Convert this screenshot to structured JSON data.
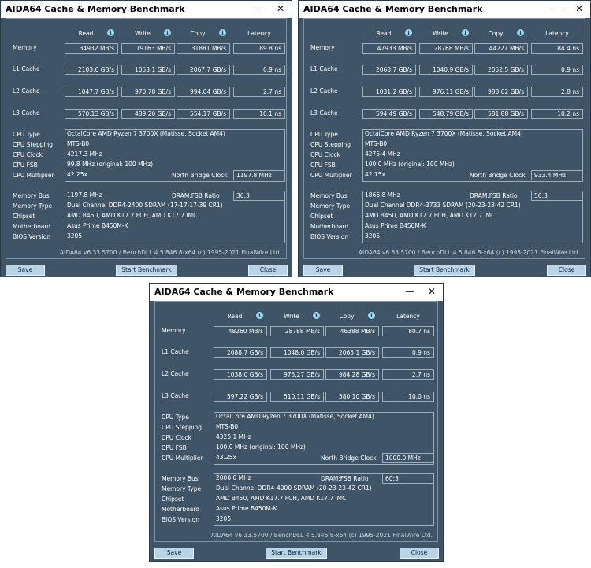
{
  "windows": [
    {
      "title": "AIDA64 Cache & Memory Benchmark",
      "headers": {
        "read": "Read",
        "write": "Write",
        "copy": "Copy",
        "latency": "Latency"
      },
      "rows": [
        {
          "label": "Memory",
          "read": "34932 MB/s",
          "write": "19163 MB/s",
          "copy": "31881 MB/s",
          "latency": "89.8 ns"
        },
        {
          "label": "L1 Cache",
          "read": "2103.6 GB/s",
          "write": "1053.1 GB/s",
          "copy": "2067.7 GB/s",
          "latency": "0.9 ns"
        },
        {
          "label": "L2 Cache",
          "read": "1047.7 GB/s",
          "write": "970.78 GB/s",
          "copy": "994.04 GB/s",
          "latency": "2.7 ns"
        },
        {
          "label": "L3 Cache",
          "read": "570.13 GB/s",
          "write": "489.20 GB/s",
          "copy": "554.17 GB/s",
          "latency": "10.1 ns"
        }
      ],
      "cpu": {
        "type_label": "CPU Type",
        "type": "OctalCore AMD Ryzen 7 3700X  (Matisse, Socket AM4)",
        "stepping_label": "CPU Stepping",
        "stepping": "MTS-B0",
        "clock_label": "CPU Clock",
        "clock": "4217.3 MHz",
        "fsb_label": "CPU FSB",
        "fsb": "99.8 MHz  (original: 100 MHz)",
        "mult_label": "CPU Multiplier",
        "mult": "42.25x",
        "nb_label": "North Bridge Clock",
        "nb": "1197.8 MHz"
      },
      "mem": {
        "bus_label": "Memory Bus",
        "bus": "1197.8 MHz",
        "ratio_label": "DRAM:FSB Ratio",
        "ratio": "36:3",
        "type_label": "Memory Type",
        "type": "Dual Channel DDR4-2400 SDRAM  (17-17-17-39 CR1)",
        "chipset_label": "Chipset",
        "chipset": "AMD B450, AMD K17.7 FCH, AMD K17.7 IMC",
        "mb_label": "Motherboard",
        "mb": "Asus Prime B450M-K",
        "bios_label": "BIOS Version",
        "bios": "3205"
      },
      "footer": "AIDA64 v6.33.5700 / BenchDLL 4.5.846.8-x64  (c) 1995-2021 FinalWire Ltd.",
      "buttons": {
        "save": "Save",
        "start": "Start Benchmark",
        "close": "Close"
      }
    },
    {
      "title": "AIDA64 Cache & Memory Benchmark",
      "headers": {
        "read": "Read",
        "write": "Write",
        "copy": "Copy",
        "latency": "Latency"
      },
      "rows": [
        {
          "label": "Memory",
          "read": "47933 MB/s",
          "write": "28768 MB/s",
          "copy": "44227 MB/s",
          "latency": "84.4 ns"
        },
        {
          "label": "L1 Cache",
          "read": "2068.7 GB/s",
          "write": "1040.9 GB/s",
          "copy": "2052.5 GB/s",
          "latency": "0.9 ns"
        },
        {
          "label": "L2 Cache",
          "read": "1031.2 GB/s",
          "write": "976.11 GB/s",
          "copy": "988.62 GB/s",
          "latency": "2.8 ns"
        },
        {
          "label": "L3 Cache",
          "read": "594.49 GB/s",
          "write": "548.79 GB/s",
          "copy": "581.88 GB/s",
          "latency": "10.2 ns"
        }
      ],
      "cpu": {
        "type_label": "CPU Type",
        "type": "OctalCore AMD Ryzen 7 3700X  (Matisse, Socket AM4)",
        "stepping_label": "CPU Stepping",
        "stepping": "MTS-B0",
        "clock_label": "CPU Clock",
        "clock": "4275.4 MHz",
        "fsb_label": "CPU FSB",
        "fsb": "100.0 MHz  (original: 100 MHz)",
        "mult_label": "CPU Multiplier",
        "mult": "42.75x",
        "nb_label": "North Bridge Clock",
        "nb": "933.4 MHz"
      },
      "mem": {
        "bus_label": "Memory Bus",
        "bus": "1866.8 MHz",
        "ratio_label": "DRAM:FSB Ratio",
        "ratio": "56:3",
        "type_label": "Memory Type",
        "type": "Dual Channel DDR4-3733 SDRAM  (20-23-23-42 CR1)",
        "chipset_label": "Chipset",
        "chipset": "AMD B450, AMD K17.7 FCH, AMD K17.7 IMC",
        "mb_label": "Motherboard",
        "mb": "Asus Prime B450M-K",
        "bios_label": "BIOS Version",
        "bios": "3205"
      },
      "footer": "AIDA64 v6.33.5700 / BenchDLL 4.5.846.8-x64  (c) 1995-2021 FinalWire Ltd.",
      "buttons": {
        "save": "Save",
        "start": "Start Benchmark",
        "close": "Close"
      }
    },
    {
      "title": "AIDA64 Cache & Memory Benchmark",
      "headers": {
        "read": "Read",
        "write": "Write",
        "copy": "Copy",
        "latency": "Latency"
      },
      "rows": [
        {
          "label": "Memory",
          "read": "48260 MB/s",
          "write": "28788 MB/s",
          "copy": "46388 MB/s",
          "latency": "80.7 ns"
        },
        {
          "label": "L1 Cache",
          "read": "2088.7 GB/s",
          "write": "1048.0 GB/s",
          "copy": "2065.1 GB/s",
          "latency": "0.9 ns"
        },
        {
          "label": "L2 Cache",
          "read": "1038.0 GB/s",
          "write": "975.27 GB/s",
          "copy": "984.28 GB/s",
          "latency": "2.7 ns"
        },
        {
          "label": "L3 Cache",
          "read": "597.22 GB/s",
          "write": "510.11 GB/s",
          "copy": "580.10 GB/s",
          "latency": "10.0 ns"
        }
      ],
      "cpu": {
        "type_label": "CPU Type",
        "type": "OctalCore AMD Ryzen 7 3700X  (Matisse, Socket AM4)",
        "stepping_label": "CPU Stepping",
        "stepping": "MTS-B0",
        "clock_label": "CPU Clock",
        "clock": "4325.1 MHz",
        "fsb_label": "CPU FSB",
        "fsb": "100.0 MHz  (original: 100 MHz)",
        "mult_label": "CPU Multiplier",
        "mult": "43.25x",
        "nb_label": "North Bridge Clock",
        "nb": "1000.0 MHz"
      },
      "mem": {
        "bus_label": "Memory Bus",
        "bus": "2000.0 MHz",
        "ratio_label": "DRAM:FSB Ratio",
        "ratio": "60:3",
        "type_label": "Memory Type",
        "type": "Dual Channel DDR4-4000 SDRAM  (20-23-23-42 CR1)",
        "chipset_label": "Chipset",
        "chipset": "AMD B450, AMD K17.7 FCH, AMD K17.7 IMC",
        "mb_label": "Motherboard",
        "mb": "Asus Prime B450M-K",
        "bios_label": "BIOS Version",
        "bios": "3205"
      },
      "footer": "AIDA64 v6.33.5700 / BenchDLL 4.5.846.8-x64  (c) 1995-2021 FinalWire Ltd.",
      "buttons": {
        "save": "Save",
        "start": "Start Benchmark",
        "close": "Close"
      }
    }
  ],
  "icons": {
    "minimize": "minimize-icon",
    "close": "close-icon",
    "info": "info-icon"
  },
  "colors": {
    "window_bg": "#3f5466",
    "button_bg": "#b9d3e8",
    "info_icon": "#9fd8f0"
  }
}
